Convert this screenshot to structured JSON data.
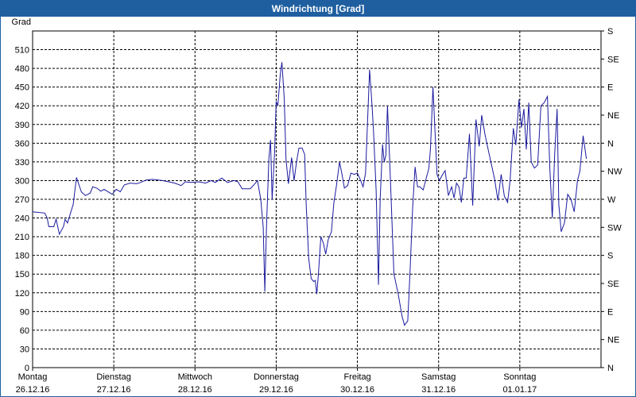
{
  "window": {
    "title": "Windrichtung [Grad]"
  },
  "chart_data": {
    "type": "line",
    "title": "Windrichtung [Grad]",
    "ylabel": "Grad",
    "ylim": [
      0,
      540
    ],
    "yticks": [
      0,
      30,
      60,
      90,
      120,
      150,
      180,
      210,
      240,
      270,
      300,
      330,
      360,
      390,
      420,
      450,
      480,
      510
    ],
    "right_axis_labels": [
      "N",
      "NE",
      "E",
      "SE",
      "S",
      "SW",
      "W",
      "NW",
      "N",
      "NE",
      "E",
      "SE",
      "S"
    ],
    "xlim": [
      0,
      7
    ],
    "x_unit": "days since Montag 26.12.16 00:00",
    "xticks": [
      {
        "day": "Montag",
        "date": "26.12.16"
      },
      {
        "day": "Dienstag",
        "date": "27.12.16"
      },
      {
        "day": "Mittwoch",
        "date": "28.12.16"
      },
      {
        "day": "Donnerstag",
        "date": "29.12.16"
      },
      {
        "day": "Freitag",
        "date": "30.12.16"
      },
      {
        "day": "Samstag",
        "date": "31.12.16"
      },
      {
        "day": "Sonntag",
        "date": "01.01.17"
      }
    ],
    "grid": true,
    "line_color": "#1a1aa0",
    "series": [
      {
        "values": [
          [
            0.0,
            250
          ],
          [
            0.15,
            248
          ],
          [
            0.18,
            240
          ],
          [
            0.2,
            226
          ],
          [
            0.26,
            226
          ],
          [
            0.29,
            238
          ],
          [
            0.33,
            214
          ],
          [
            0.38,
            226
          ],
          [
            0.4,
            238
          ],
          [
            0.43,
            232
          ],
          [
            0.5,
            262
          ],
          [
            0.54,
            305
          ],
          [
            0.6,
            282
          ],
          [
            0.65,
            276
          ],
          [
            0.71,
            280
          ],
          [
            0.74,
            290
          ],
          [
            0.79,
            288
          ],
          [
            0.84,
            283
          ],
          [
            0.88,
            286
          ],
          [
            0.93,
            282
          ],
          [
            0.98,
            278
          ],
          [
            1.03,
            286
          ],
          [
            1.08,
            282
          ],
          [
            1.13,
            293
          ],
          [
            1.2,
            296
          ],
          [
            1.28,
            295
          ],
          [
            1.33,
            297
          ],
          [
            1.4,
            301
          ],
          [
            1.48,
            302
          ],
          [
            1.6,
            300
          ],
          [
            1.75,
            296
          ],
          [
            1.83,
            292
          ],
          [
            1.88,
            298
          ],
          [
            1.95,
            297
          ],
          [
            2.05,
            298
          ],
          [
            2.13,
            296
          ],
          [
            2.2,
            300
          ],
          [
            2.25,
            297
          ],
          [
            2.33,
            304
          ],
          [
            2.4,
            297
          ],
          [
            2.48,
            300
          ],
          [
            2.53,
            298
          ],
          [
            2.58,
            287
          ],
          [
            2.68,
            287
          ],
          [
            2.73,
            294
          ],
          [
            2.77,
            300
          ],
          [
            2.81,
            270
          ],
          [
            2.84,
            225
          ],
          [
            2.86,
            122
          ],
          [
            2.88,
            225
          ],
          [
            2.91,
            335
          ],
          [
            2.93,
            365
          ],
          [
            2.95,
            270
          ],
          [
            2.98,
            345
          ],
          [
            3.0,
            427
          ],
          [
            3.02,
            420
          ],
          [
            3.05,
            470
          ],
          [
            3.07,
            490
          ],
          [
            3.1,
            430
          ],
          [
            3.12,
            335
          ],
          [
            3.15,
            295
          ],
          [
            3.19,
            337
          ],
          [
            3.22,
            300
          ],
          [
            3.25,
            330
          ],
          [
            3.28,
            352
          ],
          [
            3.32,
            352
          ],
          [
            3.35,
            342
          ],
          [
            3.37,
            260
          ],
          [
            3.4,
            175
          ],
          [
            3.43,
            143
          ],
          [
            3.46,
            138
          ],
          [
            3.48,
            140
          ],
          [
            3.5,
            118
          ],
          [
            3.52,
            150
          ],
          [
            3.55,
            210
          ],
          [
            3.58,
            200
          ],
          [
            3.61,
            182
          ],
          [
            3.64,
            205
          ],
          [
            3.68,
            218
          ],
          [
            3.71,
            265
          ],
          [
            3.74,
            290
          ],
          [
            3.78,
            330
          ],
          [
            3.81,
            310
          ],
          [
            3.84,
            288
          ],
          [
            3.88,
            292
          ],
          [
            3.92,
            312
          ],
          [
            3.96,
            310
          ],
          [
            4.0,
            312
          ],
          [
            4.04,
            300
          ],
          [
            4.07,
            290
          ],
          [
            4.1,
            312
          ],
          [
            4.13,
            410
          ],
          [
            4.15,
            478
          ],
          [
            4.18,
            420
          ],
          [
            4.2,
            375
          ],
          [
            4.23,
            285
          ],
          [
            4.26,
            133
          ],
          [
            4.28,
            270
          ],
          [
            4.31,
            358
          ],
          [
            4.33,
            330
          ],
          [
            4.35,
            340
          ],
          [
            4.37,
            420
          ],
          [
            4.4,
            325
          ],
          [
            4.45,
            150
          ],
          [
            4.5,
            120
          ],
          [
            4.55,
            82
          ],
          [
            4.58,
            68
          ],
          [
            4.62,
            75
          ],
          [
            4.65,
            160
          ],
          [
            4.68,
            255
          ],
          [
            4.71,
            322
          ],
          [
            4.74,
            290
          ],
          [
            4.77,
            290
          ],
          [
            4.81,
            285
          ],
          [
            4.85,
            305
          ],
          [
            4.88,
            320
          ],
          [
            4.9,
            352
          ],
          [
            4.93,
            450
          ],
          [
            4.95,
            395
          ],
          [
            4.98,
            310
          ],
          [
            5.01,
            300
          ],
          [
            5.05,
            310
          ],
          [
            5.08,
            316
          ],
          [
            5.12,
            276
          ],
          [
            5.16,
            290
          ],
          [
            5.19,
            272
          ],
          [
            5.22,
            296
          ],
          [
            5.25,
            290
          ],
          [
            5.28,
            265
          ],
          [
            5.31,
            304
          ],
          [
            5.34,
            304
          ],
          [
            5.38,
            375
          ],
          [
            5.42,
            260
          ],
          [
            5.46,
            398
          ],
          [
            5.5,
            355
          ],
          [
            5.53,
            405
          ],
          [
            5.57,
            375
          ],
          [
            5.61,
            350
          ],
          [
            5.65,
            326
          ],
          [
            5.69,
            302
          ],
          [
            5.73,
            268
          ],
          [
            5.77,
            310
          ],
          [
            5.81,
            275
          ],
          [
            5.85,
            265
          ],
          [
            5.88,
            300
          ],
          [
            5.92,
            384
          ],
          [
            5.95,
            357
          ],
          [
            5.99,
            430
          ],
          [
            6.02,
            385
          ],
          [
            6.05,
            415
          ],
          [
            6.08,
            350
          ],
          [
            6.11,
            425
          ],
          [
            6.14,
            330
          ],
          [
            6.18,
            320
          ],
          [
            6.22,
            325
          ],
          [
            6.26,
            420
          ],
          [
            6.3,
            425
          ],
          [
            6.34,
            435
          ],
          [
            6.37,
            320
          ],
          [
            6.4,
            240
          ],
          [
            6.43,
            345
          ],
          [
            6.46,
            415
          ],
          [
            6.48,
            262
          ],
          [
            6.51,
            218
          ],
          [
            6.55,
            232
          ],
          [
            6.59,
            278
          ],
          [
            6.63,
            270
          ],
          [
            6.67,
            250
          ],
          [
            6.71,
            300
          ],
          [
            6.74,
            315
          ],
          [
            6.78,
            372
          ],
          [
            6.82,
            335
          ]
        ]
      }
    ]
  }
}
